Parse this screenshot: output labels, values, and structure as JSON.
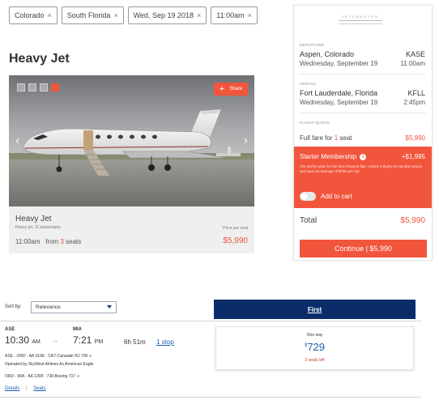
{
  "filters": [
    {
      "label": "Colorado",
      "close": "×"
    },
    {
      "label": "South Florida",
      "close": "×"
    },
    {
      "label": "Wed, Sep 19 2018",
      "close": "×"
    },
    {
      "label": "11:00am",
      "close": "×"
    }
  ],
  "heading": "Heavy Jet",
  "jet_card": {
    "share_label": "Share",
    "share_plus": "+",
    "arrow_left": "‹",
    "arrow_right": "›",
    "name": "Heavy Jet",
    "subtitle": "Heavy jet, 11 passengers",
    "price_label": "Price per seat",
    "time": "11:00am",
    "from_text": "from",
    "seats_count": "3",
    "seats_word": "seats",
    "price": "$5,990"
  },
  "booking": {
    "logo_text": "JETSMARTER",
    "departure_label": "DEPARTURE",
    "departure_city": "Aspen, Colorado",
    "departure_code": "KASE",
    "departure_date": "Wednesday, September 19",
    "departure_time": "11:00am",
    "arrival_label": "ARRIVAL",
    "arrival_city": "Fort Lauderdale, Florida",
    "arrival_code": "KFLL",
    "arrival_date": "Wednesday, September 19",
    "arrival_time": "2:45pm",
    "quote_label": "FLIGHT QUOTE",
    "fare_text": "Full fare for",
    "fare_count": "1",
    "fare_unit": "seat",
    "fare_price": "$5,990",
    "membership_title": "Starter Membership",
    "membership_info": "i",
    "membership_price": "+$1,995",
    "membership_desc": "The perfect plan for the less frequent flier. Unlock 6 flights at member prices and save an average of $750 per trip.",
    "add_to_cart": "Add to cart",
    "total_label": "Total",
    "total_price": "$5,990",
    "continue_label": "Continue | $5,990"
  },
  "search": {
    "sort_label": "Sort by:",
    "sort_value": "Relevance",
    "cabin_tab": "First"
  },
  "flight": {
    "origin_code": "ASE",
    "origin_time": "10:30",
    "origin_ampm": "AM",
    "arrow": "→",
    "dest_code": "MIA",
    "dest_time": "7:21",
    "dest_ampm": "PM",
    "duration": "6h  51m",
    "stops": "1 stop",
    "seg1": "ASE - ORD  ·  AA 3168  ·  CR7-Canadair RJ 700",
    "seg1_note": "Operated by SkyWest Airlines As American Eagle",
    "seg2": "ORD - MIA  ·  AA 1308  ·  738-Boeing 737",
    "wifi": "≋",
    "details_link": "Details",
    "link_sep": "|",
    "seats_link": "Seats"
  },
  "fare": {
    "type": "One way",
    "currency": "$",
    "amount": "729",
    "seats_left": "2 seats left"
  },
  "colors": {
    "accent": "#f1553c",
    "navy": "#0a2d6a",
    "link": "#1a5fb4"
  }
}
